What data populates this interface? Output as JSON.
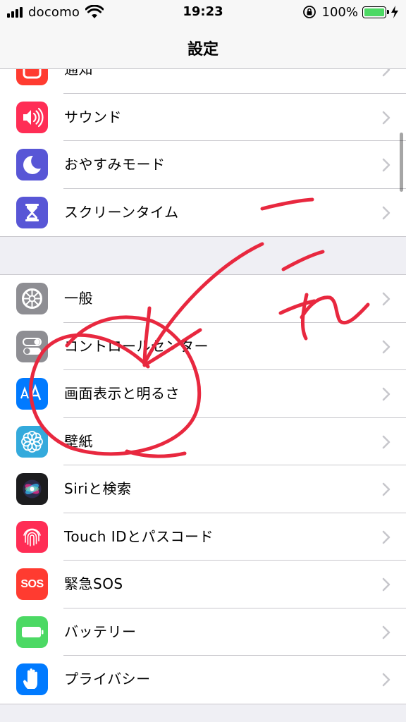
{
  "status_bar": {
    "carrier": "docomo",
    "time": "19:23",
    "battery": "100%",
    "battery_level": 1.0
  },
  "nav": {
    "title": "設定"
  },
  "group1": [
    {
      "label": "通知",
      "icon": "notifications-icon",
      "color": "#ff3b30"
    },
    {
      "label": "サウンド",
      "icon": "speaker-icon",
      "color": "#ff2d55"
    },
    {
      "label": "おやすみモード",
      "icon": "moon-icon",
      "color": "#5856d6"
    },
    {
      "label": "スクリーンタイム",
      "icon": "hourglass-icon",
      "color": "#5856d6"
    }
  ],
  "group2": [
    {
      "label": "一般",
      "icon": "gear-icon",
      "color": "#8e8e93"
    },
    {
      "label": "コントロールセンター",
      "icon": "toggles-icon",
      "color": "#8e8e93"
    },
    {
      "label": "画面表示と明るさ",
      "icon": "text-size-icon",
      "color": "#007aff"
    },
    {
      "label": "壁紙",
      "icon": "flower-icon",
      "color": "#34aadc"
    },
    {
      "label": "Siriと検索",
      "icon": "siri-icon",
      "color": "#1c1c1e"
    },
    {
      "label": "Touch IDとパスコード",
      "icon": "fingerprint-icon",
      "color": "#ff2d55"
    },
    {
      "label": "緊急SOS",
      "icon": "sos-icon",
      "color": "#ff3b30"
    },
    {
      "label": "バッテリー",
      "icon": "battery-icon",
      "color": "#4cd964"
    },
    {
      "label": "プライバシー",
      "icon": "hand-icon",
      "color": "#007aff"
    }
  ],
  "sos_icon_text": "SOS",
  "annotation_color": "#e8283f"
}
